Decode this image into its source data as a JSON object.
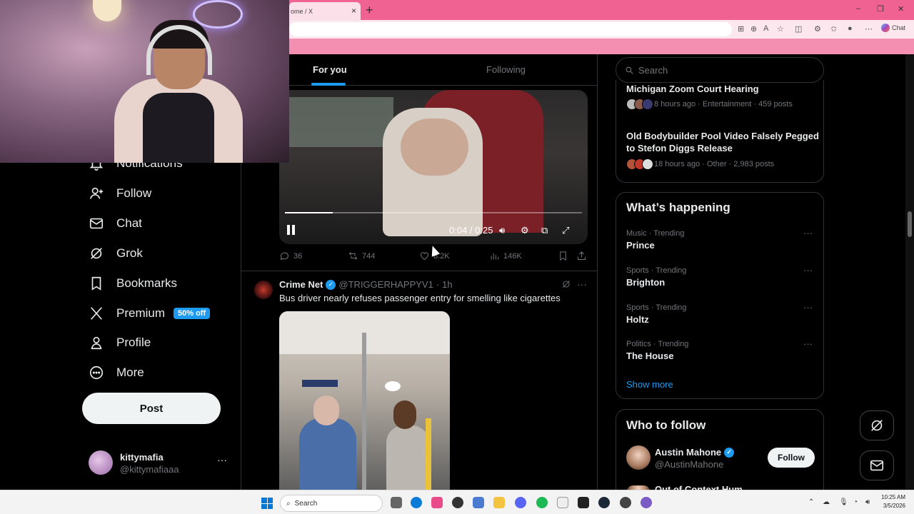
{
  "browser": {
    "tab_title": "ome / X",
    "tab_close": "×",
    "new_tab": "+",
    "chat_label": "Chat",
    "window_controls": [
      "–",
      "❐",
      "✕"
    ]
  },
  "nav": {
    "items": [
      {
        "label": "Notifications",
        "icon": "bell-icon"
      },
      {
        "label": "Follow",
        "icon": "follow-icon"
      },
      {
        "label": "Chat",
        "icon": "mail-icon"
      },
      {
        "label": "Grok",
        "icon": "grok-icon"
      },
      {
        "label": "Bookmarks",
        "icon": "bookmark-icon"
      },
      {
        "label": "Premium",
        "icon": "x-logo-icon"
      },
      {
        "label": "Profile",
        "icon": "person-icon"
      },
      {
        "label": "More",
        "icon": "more-circle-icon"
      }
    ],
    "premium_badge": "50% off",
    "post_button": "Post",
    "account": {
      "name": "kittymafia",
      "handle": "@kittymafiaaa",
      "more": "···"
    }
  },
  "feed": {
    "tabs": {
      "for_you": "For you",
      "following": "Following"
    },
    "video": {
      "time": "0:04 / 0:25",
      "progress": 0.16
    },
    "video_actions": {
      "replies": "36",
      "reposts": "744",
      "likes": "8.2K",
      "views": "146K"
    },
    "tweet": {
      "name": "Crime Net",
      "handle": "@TRIGGERHAPPYV1",
      "separator": "·",
      "time": "1h",
      "more": "···",
      "text": "Bus driver nearly refuses passenger entry for smelling like cigarettes"
    }
  },
  "right": {
    "search_placeholder": "Search",
    "news": [
      {
        "title": "Michigan Zoom Court Hearing",
        "meta": "8 hours ago · Entertainment · 459 posts"
      },
      {
        "title": "Old Bodybuilder Pool Video Falsely Pegged to Stefon Diggs Release",
        "meta": "18 hours ago · Other · 2,983 posts"
      }
    ],
    "happening": {
      "title": "What’s happening",
      "trends": [
        {
          "category": "Music · Trending",
          "name": "Prince"
        },
        {
          "category": "Sports · Trending",
          "name": "Brighton"
        },
        {
          "category": "Sports · Trending",
          "name": "Holtz"
        },
        {
          "category": "Politics · Trending",
          "name": "The House"
        }
      ],
      "more": "···",
      "show_more": "Show more"
    },
    "who_to_follow": {
      "title": "Who to follow",
      "user": {
        "name": "Austin Mahone",
        "handle": "@AustinMahone",
        "button": "Follow"
      },
      "next_user_partial": "Out of Context Hum"
    }
  },
  "taskbar": {
    "search_label": "Search",
    "time": "10:25 AM",
    "date": "3/5/2026"
  }
}
